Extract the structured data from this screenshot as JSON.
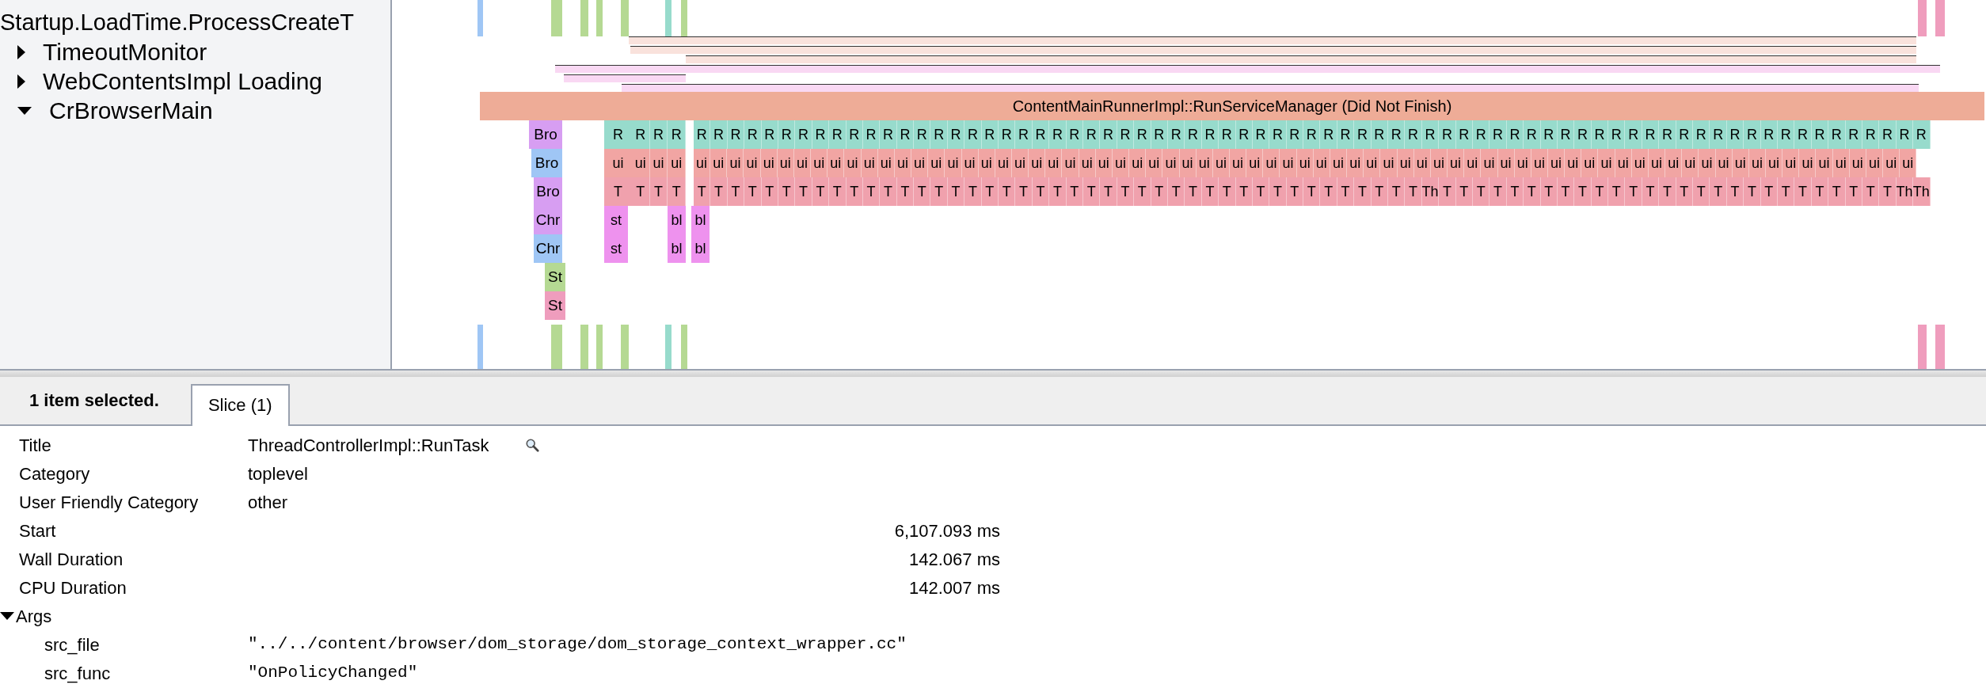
{
  "sidebar": {
    "cut_label": "Startup.LoadTime.ProcessCreateT",
    "tracks": [
      {
        "label": "TimeoutMonitor",
        "expanded": false
      },
      {
        "label": "WebContentsImpl Loading",
        "expanded": false
      },
      {
        "label": "CrBrowserMain",
        "expanded": true
      }
    ]
  },
  "flame": {
    "top_slice": "ContentMainRunnerImpl::RunServiceManager (Did Not Finish)",
    "rows": [
      {
        "lead": {
          "label": "Bro",
          "color": "#d79ef2"
        },
        "color": "#97dbcc",
        "groups": [
          [
            "R"
          ],
          [
            "R",
            "R",
            "R"
          ],
          [
            "R",
            "R",
            "R",
            "R",
            "R",
            "R",
            "R",
            "R",
            "R",
            "R",
            "R",
            "R",
            "R",
            "R",
            "R",
            "R",
            "R",
            "R",
            "R",
            "R",
            "R",
            "R",
            "R",
            "R",
            "R",
            "R",
            "R",
            "R",
            "R",
            "R",
            "R",
            "R",
            "R",
            "R",
            "R",
            "R",
            "R",
            "R",
            "R",
            "R",
            "R",
            "R",
            "R",
            "R",
            "R",
            "R",
            "R",
            "R",
            "R",
            "R",
            "R",
            "R",
            "R",
            "R",
            "R",
            "R",
            "R",
            "R",
            "R",
            "R",
            "R",
            "R",
            "R",
            "R",
            "R",
            "R",
            "R",
            "R",
            "R",
            "R",
            "R",
            "R",
            "R"
          ]
        ]
      },
      {
        "lead": {
          "label": "Bro",
          "color": "#9fc6f5"
        },
        "color": "#f1a5a3",
        "groups": [
          [
            "ui"
          ],
          [
            "ui",
            "ui",
            "ui"
          ],
          [
            "ui",
            "ui",
            "ui",
            "ui",
            "ui",
            "ui",
            "ui",
            "ui",
            "ui",
            "ui",
            "ui",
            "ui",
            "ui",
            "ui",
            "ui",
            "ui",
            "ui",
            "ui",
            "ui",
            "ui",
            "ui",
            "ui",
            "ui",
            "ui",
            "ui",
            "ui",
            "ui",
            "ui",
            "ui",
            "ui",
            "ui",
            "ui",
            "ui",
            "ui",
            "ui",
            "ui",
            "ui",
            "ui",
            "ui",
            "ui",
            "ui",
            "ui",
            "ui",
            "ui",
            "ui",
            "ui",
            "ui",
            "ui",
            "ui",
            "ui",
            "ui",
            "ui",
            "ui",
            "ui",
            "ui",
            "ui",
            "ui",
            "ui",
            "ui",
            "ui",
            "ui",
            "ui",
            "ui",
            "ui",
            "ui",
            "ui",
            "ui",
            "ui",
            "ui",
            "ui",
            "ui",
            "ui",
            "ui"
          ]
        ]
      },
      {
        "lead": {
          "label": "Bro",
          "color": "#d79ef2"
        },
        "color": "#f0a1ad",
        "groups": [
          [
            "T"
          ],
          [
            "T",
            "T",
            "T"
          ],
          [
            "T",
            "T",
            "T",
            "T",
            "T",
            "T",
            "T",
            "T",
            "T",
            "T",
            "T",
            "T",
            "T",
            "T",
            "T",
            "T",
            "T",
            "T",
            "T",
            "T",
            "T",
            "T",
            "T",
            "T",
            "T",
            "T",
            "T",
            "T",
            "T",
            "T",
            "T",
            "T",
            "T",
            "T",
            "T",
            "T",
            "T",
            "T",
            "T",
            "T",
            "T",
            "T",
            "T",
            "Th",
            "T",
            "T",
            "T",
            "T",
            "T",
            "T",
            "T",
            "T",
            "T",
            "T",
            "T",
            "T",
            "T",
            "T",
            "T",
            "T",
            "T",
            "T",
            "T",
            "T",
            "T",
            "T",
            "T",
            "T",
            "T",
            "T",
            "T",
            "Th",
            "Th"
          ]
        ]
      },
      {
        "lead": {
          "label": "Chr",
          "color": "#d79ef2"
        },
        "color": "#ee92ee",
        "groups": [
          [
            "st"
          ],
          [
            "bl"
          ],
          [
            "bl"
          ]
        ]
      },
      {
        "lead": {
          "label": "Chr",
          "color": "#9fc6f5"
        },
        "color": "#ee92ee",
        "groups": [
          [
            "st"
          ],
          [
            "bl"
          ],
          [
            "bl"
          ]
        ]
      },
      {
        "lead": {
          "label": "St",
          "color": "#b5d993"
        },
        "groups": []
      },
      {
        "lead": {
          "label": "St",
          "color": "#ef9dbd"
        },
        "groups": []
      }
    ]
  },
  "panel": {
    "summary": "1 item selected.",
    "tabs": [
      {
        "label": "Slice (1)",
        "selected": true
      }
    ],
    "details": [
      {
        "label": "Title",
        "value": "ThreadControllerImpl::RunTask",
        "kind": "title"
      },
      {
        "label": "Category",
        "value": "toplevel",
        "kind": "text"
      },
      {
        "label": "User Friendly Category",
        "value": "other",
        "kind": "text"
      },
      {
        "label": "Start",
        "value": "6,107.093 ms",
        "kind": "number"
      },
      {
        "label": "Wall Duration",
        "value": "142.067 ms",
        "kind": "number"
      },
      {
        "label": "CPU Duration",
        "value": "142.007 ms",
        "kind": "number"
      }
    ],
    "args": {
      "label": "Args",
      "expanded": true,
      "items": [
        {
          "name": "src_file",
          "value": "\"../../content/browser/dom_storage/dom_storage_context_wrapper.cc\""
        },
        {
          "name": "src_func",
          "value": "\"OnPolicyChanged\""
        }
      ]
    }
  }
}
